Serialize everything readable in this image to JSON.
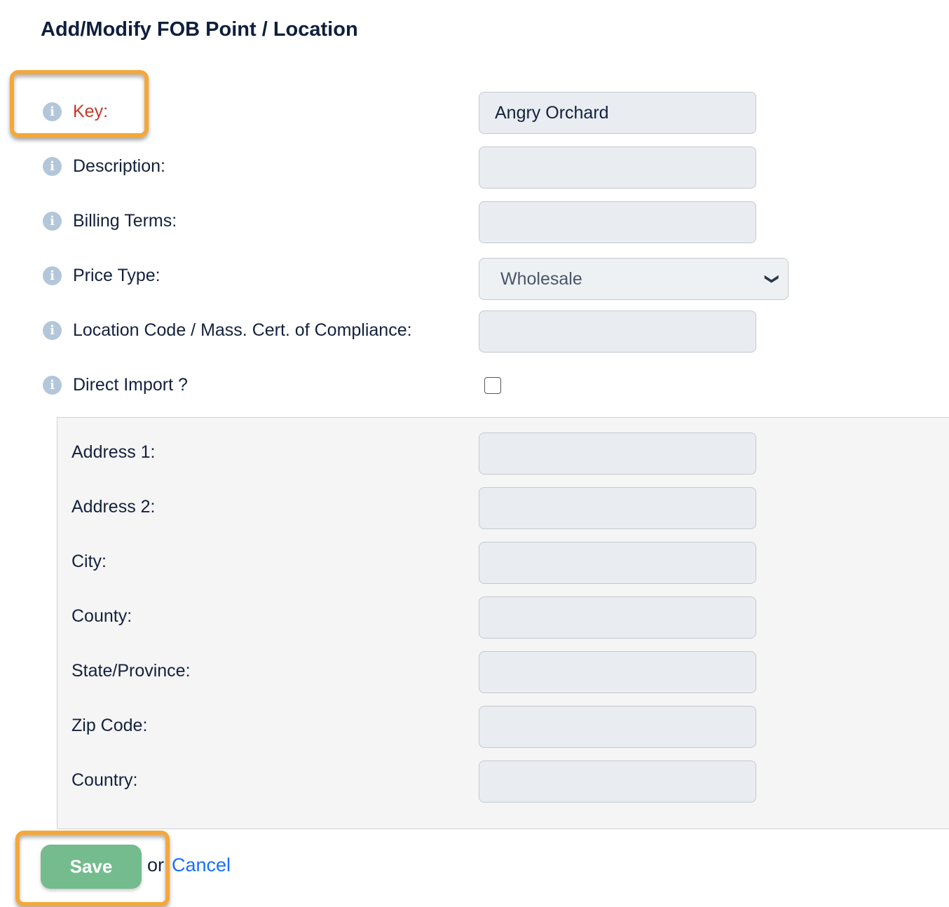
{
  "title": "Add/Modify FOB Point / Location",
  "fields": [
    {
      "label": "Key:",
      "value": "Angry Orchard",
      "required": true
    },
    {
      "label": "Description:",
      "value": ""
    },
    {
      "label": "Billing Terms:",
      "value": ""
    },
    {
      "label": "Price Type:",
      "value": "Wholesale"
    },
    {
      "label": "Location Code / Mass. Cert. of Compliance:",
      "value": ""
    },
    {
      "label": "Direct Import ?",
      "checked": false
    }
  ],
  "address": [
    {
      "label": "Address 1:",
      "value": ""
    },
    {
      "label": "Address 2:",
      "value": ""
    },
    {
      "label": "City:",
      "value": ""
    },
    {
      "label": "County:",
      "value": ""
    },
    {
      "label": "State/Province:",
      "value": ""
    },
    {
      "label": "Zip Code:",
      "value": ""
    },
    {
      "label": "Country:",
      "value": ""
    }
  ],
  "actions": {
    "save": "Save",
    "or": "or",
    "cancel": "Cancel"
  },
  "icons": {
    "info": "i",
    "chevron": "⌄"
  },
  "colors": {
    "required": "#c0392b",
    "save": "#74bb8e",
    "link": "#1a6dff",
    "highlight": "#f3a83b"
  }
}
